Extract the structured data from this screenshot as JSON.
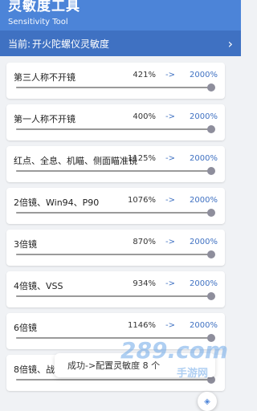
{
  "header": {
    "title": "灵敏度工具",
    "subtitle": "Sensitivity Tool"
  },
  "current": {
    "label": "当前:",
    "value": "开火陀螺仪灵敏度",
    "chevron_icon": "chevron-right-icon"
  },
  "items": [
    {
      "name": "第三人称不开镜",
      "from": "421%",
      "arrow": "->",
      "to": "2000%",
      "slider_percent": 98
    },
    {
      "name": "第一人称不开镜",
      "from": "400%",
      "arrow": "->",
      "to": "2000%",
      "slider_percent": 98
    },
    {
      "name": "红点、全息、机瞄、侧面瞄准镜",
      "from": "1125%",
      "arrow": "->",
      "to": "2000%",
      "slider_percent": 98
    },
    {
      "name": "2倍镜、Win94、P90",
      "from": "1076%",
      "arrow": "->",
      "to": "2000%",
      "slider_percent": 98
    },
    {
      "name": "3倍镜",
      "from": "870%",
      "arrow": "->",
      "to": "2000%",
      "slider_percent": 98
    },
    {
      "name": "4倍镜、VSS",
      "from": "934%",
      "arrow": "->",
      "to": "2000%",
      "slider_percent": 98
    },
    {
      "name": "6倍镜",
      "from": "1146%",
      "arrow": "->",
      "to": "2000%",
      "slider_percent": 98
    },
    {
      "name": "8倍镜、战术",
      "from": "",
      "arrow": "",
      "to": "",
      "slider_percent": 98
    }
  ],
  "toast": {
    "text": "成功->配置灵敏度 8 个"
  },
  "watermark": {
    "big": "289.com",
    "small": "手游网"
  },
  "fab": {
    "icon": "layers-icon"
  },
  "colors": {
    "header": "#4c84d8",
    "current_bar": "#3f71c2",
    "accent": "#3f71c2",
    "background": "#f0f2f5"
  }
}
